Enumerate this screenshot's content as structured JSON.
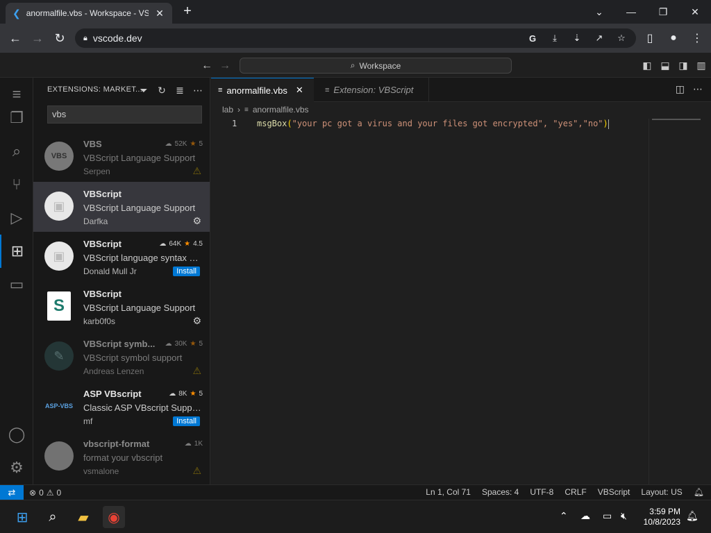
{
  "browser": {
    "tab_title": "anormalfile.vbs - Workspace - VS Code",
    "tab_close": "✕",
    "new_tab": "+",
    "url": "vscode.dev",
    "window_controls": [
      "⌄",
      "—",
      "❐",
      "✕"
    ]
  },
  "vscode": {
    "command_center": "Workspace",
    "sidebar": {
      "title": "EXTENSIONS: MARKET...",
      "search_value": "vbs",
      "extensions": [
        {
          "name": "VBS",
          "desc": "VBScript Language Support",
          "publisher": "Serpen",
          "downloads": "52K",
          "rating": "5",
          "logo": "VBS",
          "action": "warning",
          "dim": true
        },
        {
          "name": "VBScript",
          "desc": "VBScript Language Support",
          "publisher": "Darfka",
          "downloads": "",
          "rating": "",
          "logo": "",
          "action": "gear",
          "selected": true
        },
        {
          "name": "VBScript",
          "desc": "VBScript language syntax hi...",
          "publisher": "Donald Mull Jr",
          "downloads": "64K",
          "rating": "4.5",
          "logo": "",
          "action": "install"
        },
        {
          "name": "VBScript",
          "desc": "VBScript Language Support",
          "publisher": "karb0f0s",
          "downloads": "",
          "rating": "",
          "logo": "S",
          "action": "gear"
        },
        {
          "name": "VBScript symb...",
          "desc": "VBScript symbol support",
          "publisher": "Andreas Lenzen",
          "downloads": "30K",
          "rating": "5",
          "logo": "",
          "action": "warning",
          "dim": true
        },
        {
          "name": "ASP VBscript",
          "desc": "Classic ASP VBscript Suppor...",
          "publisher": "mf",
          "downloads": "8K",
          "rating": "5",
          "logo": "ASP-VBS",
          "action": "install"
        },
        {
          "name": "vbscript-format",
          "desc": "format your vbscript",
          "publisher": "vsmalone",
          "downloads": "1K",
          "rating": "",
          "logo": "",
          "action": "warning",
          "dim": true
        }
      ],
      "install_label": "Install"
    },
    "editor": {
      "tabs": [
        {
          "label": "anormalfile.vbs",
          "active": true
        },
        {
          "label": "Extension: VBScript",
          "active": false
        }
      ],
      "breadcrumb_folder": "lab",
      "breadcrumb_file": "anormalfile.vbs",
      "line_number": "1",
      "code_fn": "msgBox",
      "code_args": "\"your pc got a virus and your files got encrypted\", \"yes\",\"no\""
    },
    "status": {
      "errors": "0",
      "warnings": "0",
      "position": "Ln 1, Col 71",
      "spaces": "Spaces: 4",
      "encoding": "UTF-8",
      "eol": "CRLF",
      "language": "VBScript",
      "layout": "Layout: US"
    }
  },
  "taskbar": {
    "time": "3:59 PM",
    "date": "10/8/2023"
  }
}
